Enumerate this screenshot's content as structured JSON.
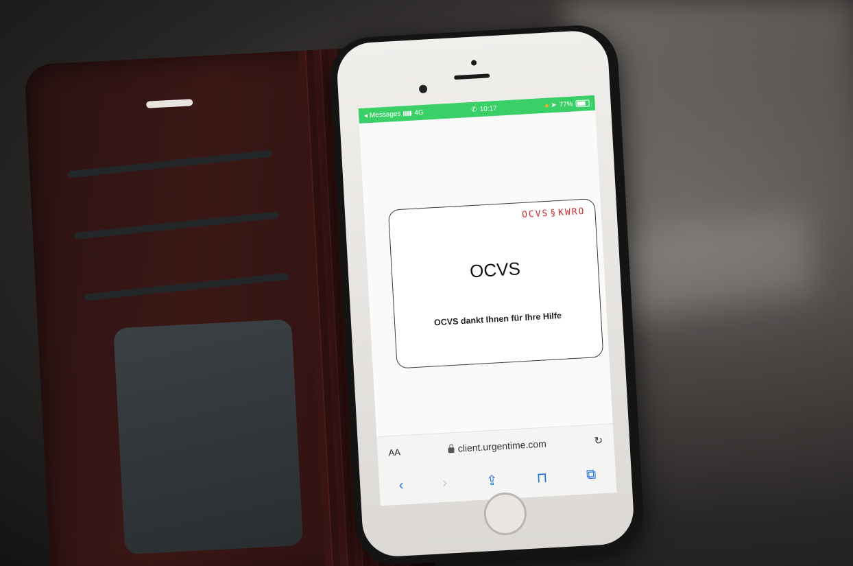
{
  "status_bar": {
    "carrier": "◂ Messages",
    "network": "4G",
    "time": "10:17",
    "battery": "77%"
  },
  "card": {
    "logo_left": "OCVS",
    "logo_right": "KWRO",
    "title": "OCVS",
    "message": "OCVS dankt Ihnen für Ihre Hilfe"
  },
  "browser": {
    "text_size_label": "AA",
    "url": "client.urgentime.com"
  },
  "colors": {
    "status_bar": "#3ad067",
    "logo": "#d0282a",
    "safari_accent": "#1b74e8"
  }
}
